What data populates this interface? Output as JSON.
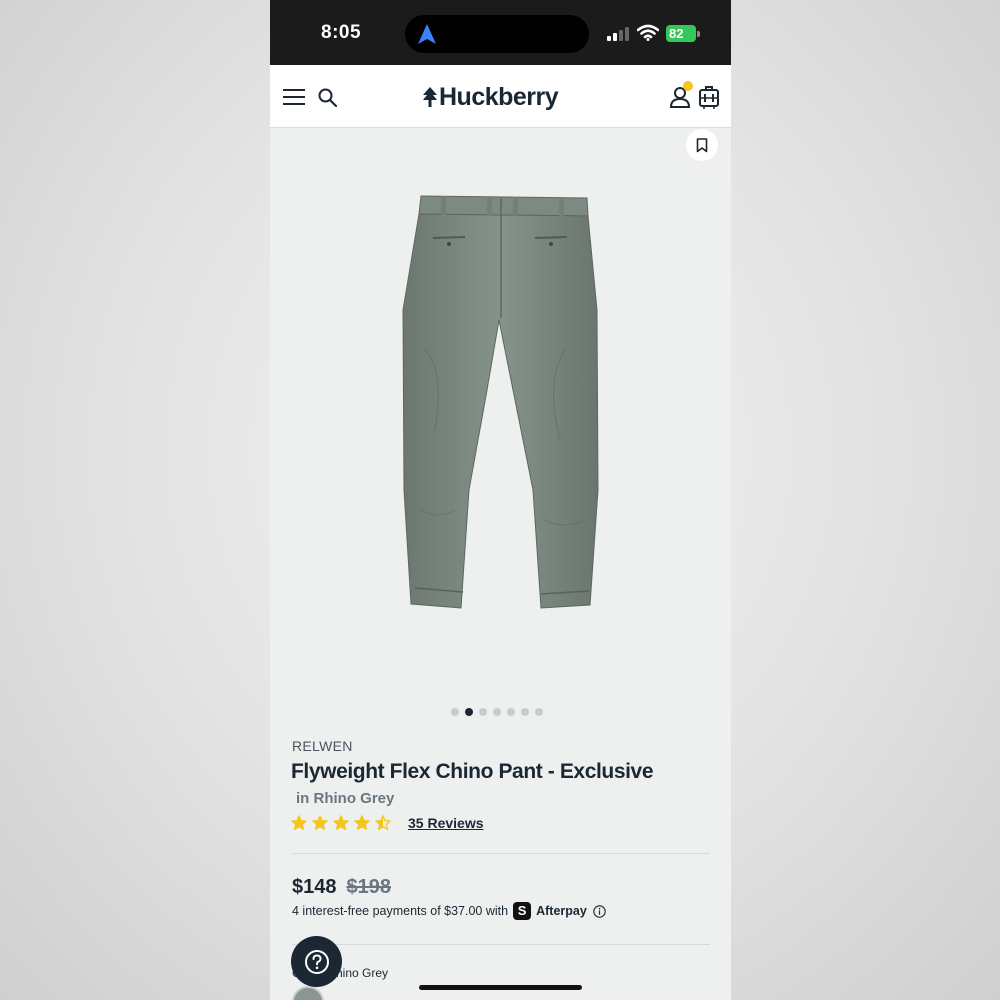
{
  "status_bar": {
    "time": "8:05",
    "battery": "82"
  },
  "header": {
    "logo_text": "Huckberry",
    "icons": [
      "menu-icon",
      "search-icon",
      "account-icon",
      "cart-icon"
    ]
  },
  "gallery": {
    "dots_total": 7,
    "active_dot": 2
  },
  "product": {
    "brand": "RELWEN",
    "title": "Flyweight Flex Chino Pant - Exclusive",
    "color_subtitle": "in Rhino Grey",
    "rating": 4.5,
    "reviews_label": "35 Reviews",
    "price": "$148",
    "original_price": "$198",
    "installments_text": "4 interest-free payments of $37.00 with",
    "afterpay_badge": "S",
    "afterpay_label": "Afterpay",
    "color_label": "Color: Rhino Grey"
  },
  "colors": {
    "brand_navy": "#1b2733",
    "star_yellow": "#f2c61b",
    "battery_green": "#34c759"
  }
}
